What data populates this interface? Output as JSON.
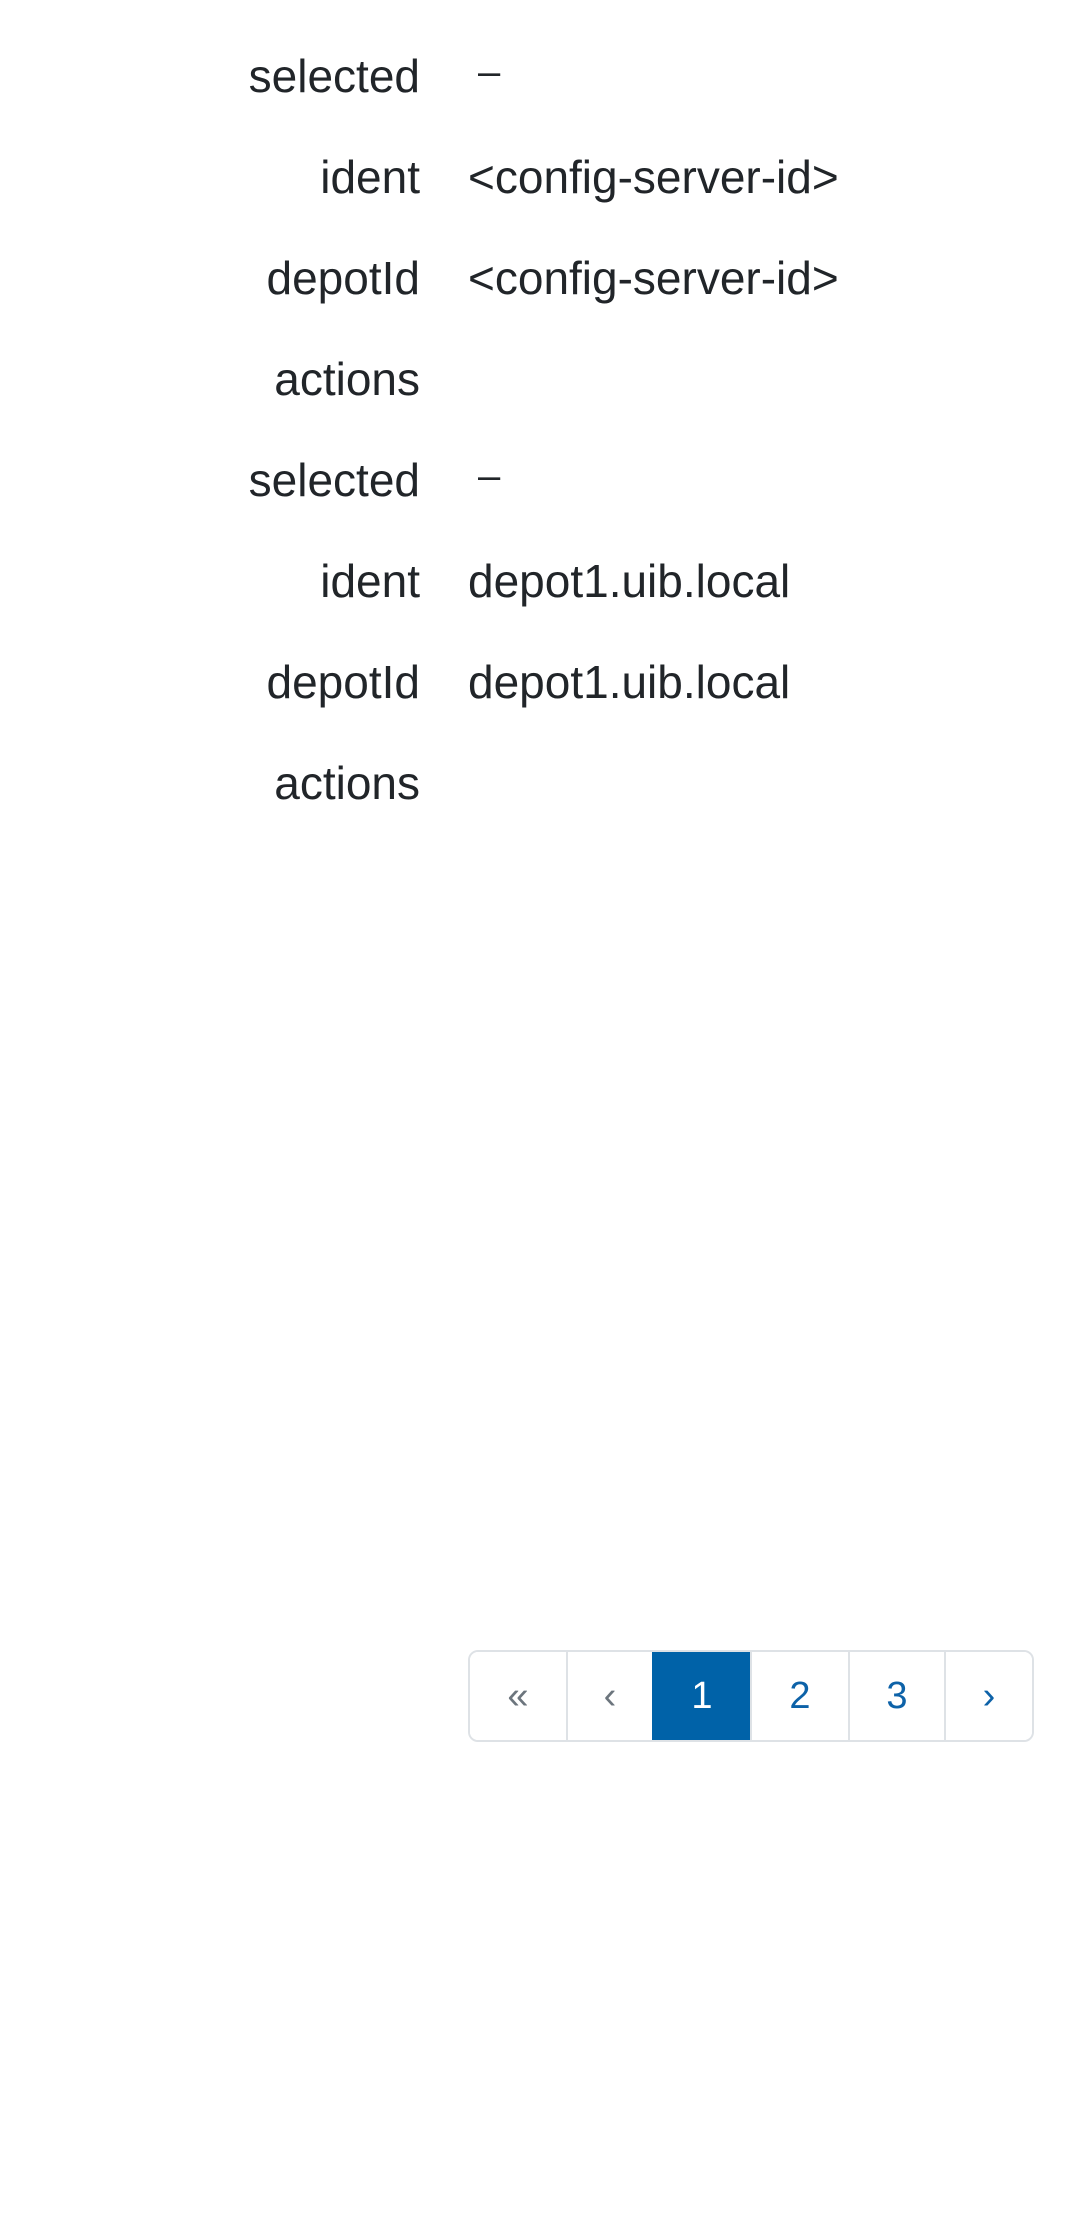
{
  "records": [
    {
      "selected_label": "selected",
      "selected_value": "–",
      "ident_label": "ident",
      "ident_value": "<config-server-id>",
      "depotId_label": "depotId",
      "depotId_value": "<config-server-id>",
      "actions_label": "actions"
    },
    {
      "selected_label": "selected",
      "selected_value": "–",
      "ident_label": "ident",
      "ident_value": "depot1.uib.local",
      "depotId_label": "depotId",
      "depotId_value": "depot1.uib.local",
      "actions_label": "actions"
    }
  ],
  "pagination": {
    "first": "«",
    "prev": "‹",
    "pages": [
      "1",
      "2",
      "3"
    ],
    "next": "›",
    "current_page": "1"
  },
  "colors": {
    "accent": "#0062a8",
    "text": "#212529",
    "border": "#dee2e6",
    "disabled": "#6c757d"
  }
}
